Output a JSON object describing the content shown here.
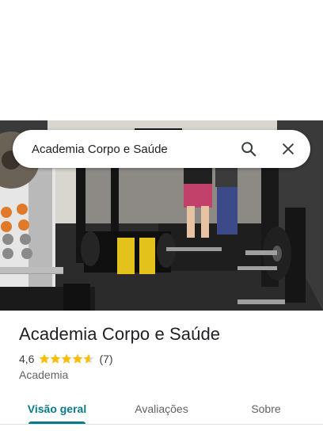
{
  "search": {
    "query": "Academia Corpo e Saúde",
    "search_icon": "search-icon",
    "close_icon": "close-icon"
  },
  "place": {
    "title": "Academia Corpo e Saúde",
    "rating": "4,6",
    "rating_stars": 4.6,
    "rating_max": 5,
    "review_count": "(7)",
    "category": "Academia",
    "star_color": "#fbbc04"
  },
  "tabs": [
    {
      "label": "Visão geral",
      "active": true
    },
    {
      "label": "Avaliações",
      "active": false
    },
    {
      "label": "Sobre",
      "active": false
    }
  ],
  "colors": {
    "accent": "#0b7a8a",
    "text": "#202124",
    "muted": "#5f6368"
  }
}
